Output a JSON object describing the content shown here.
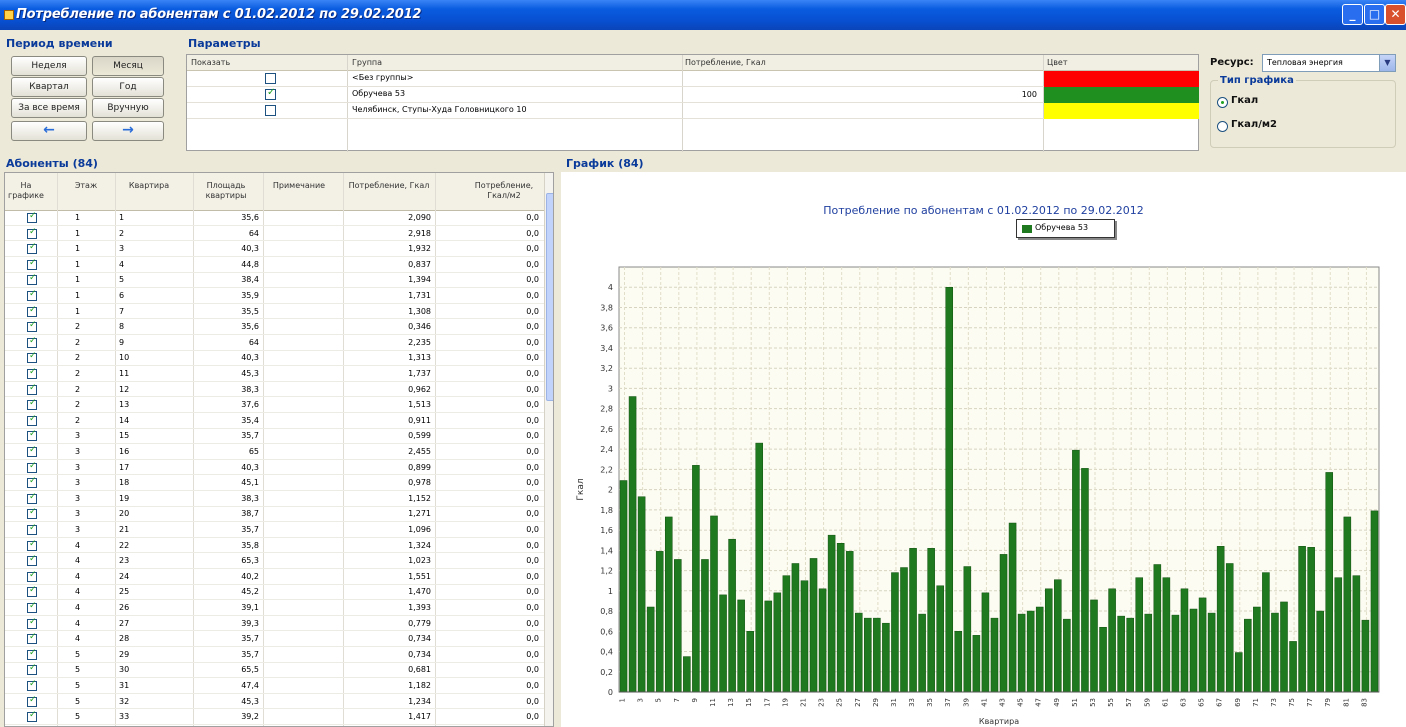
{
  "window": {
    "title": "Потребление по абонентам с 01.02.2012 по 29.02.2012"
  },
  "period": {
    "title": "Период времени",
    "buttons": [
      "Неделя",
      "Месяц",
      "Квартал",
      "Год",
      "За все время",
      "Вручную"
    ],
    "selected": "Месяц",
    "prev_icon": "arrow-left-icon",
    "next_icon": "arrow-right-icon"
  },
  "params": {
    "title": "Параметры",
    "columns": [
      "Показать",
      "Группа",
      "Потребление, Гкал",
      "Цвет"
    ],
    "rows": [
      {
        "show": false,
        "group": "<Без группы>",
        "value": "",
        "color": "#ff0000"
      },
      {
        "show": true,
        "group": "Обручева 53",
        "value": "100",
        "color": "#1f8f1f"
      },
      {
        "show": false,
        "group": "Челябинск, Ступы-Худа Головницкого 10",
        "value": "",
        "color": "#ffff00"
      }
    ]
  },
  "resource": {
    "label": "Ресурс:",
    "value": "Тепловая энергия"
  },
  "chart_type": {
    "title": "Тип графика",
    "options": [
      "Гкал",
      "Гкал/м2"
    ],
    "selected": "Гкал"
  },
  "subscribers": {
    "title": "Абоненты (84)",
    "columns": [
      "На графике",
      "Этаж",
      "Квартира",
      "Площадь квартиры",
      "Примечание",
      "Потребление, Гкал",
      "Потребление, Гкал/м2"
    ],
    "rows": [
      [
        "1",
        "1",
        "35,6",
        "",
        "2,090",
        "0,0"
      ],
      [
        "1",
        "2",
        "64",
        "",
        "2,918",
        "0,0"
      ],
      [
        "1",
        "3",
        "40,3",
        "",
        "1,932",
        "0,0"
      ],
      [
        "1",
        "4",
        "44,8",
        "",
        "0,837",
        "0,0"
      ],
      [
        "1",
        "5",
        "38,4",
        "",
        "1,394",
        "0,0"
      ],
      [
        "1",
        "6",
        "35,9",
        "",
        "1,731",
        "0,0"
      ],
      [
        "1",
        "7",
        "35,5",
        "",
        "1,308",
        "0,0"
      ],
      [
        "2",
        "8",
        "35,6",
        "",
        "0,346",
        "0,0"
      ],
      [
        "2",
        "9",
        "64",
        "",
        "2,235",
        "0,0"
      ],
      [
        "2",
        "10",
        "40,3",
        "",
        "1,313",
        "0,0"
      ],
      [
        "2",
        "11",
        "45,3",
        "",
        "1,737",
        "0,0"
      ],
      [
        "2",
        "12",
        "38,3",
        "",
        "0,962",
        "0,0"
      ],
      [
        "2",
        "13",
        "37,6",
        "",
        "1,513",
        "0,0"
      ],
      [
        "2",
        "14",
        "35,4",
        "",
        "0,911",
        "0,0"
      ],
      [
        "3",
        "15",
        "35,7",
        "",
        "0,599",
        "0,0"
      ],
      [
        "3",
        "16",
        "65",
        "",
        "2,455",
        "0,0"
      ],
      [
        "3",
        "17",
        "40,3",
        "",
        "0,899",
        "0,0"
      ],
      [
        "3",
        "18",
        "45,1",
        "",
        "0,978",
        "0,0"
      ],
      [
        "3",
        "19",
        "38,3",
        "",
        "1,152",
        "0,0"
      ],
      [
        "3",
        "20",
        "38,7",
        "",
        "1,271",
        "0,0"
      ],
      [
        "3",
        "21",
        "35,7",
        "",
        "1,096",
        "0,0"
      ],
      [
        "4",
        "22",
        "35,8",
        "",
        "1,324",
        "0,0"
      ],
      [
        "4",
        "23",
        "65,3",
        "",
        "1,023",
        "0,0"
      ],
      [
        "4",
        "24",
        "40,2",
        "",
        "1,551",
        "0,0"
      ],
      [
        "4",
        "25",
        "45,2",
        "",
        "1,470",
        "0,0"
      ],
      [
        "4",
        "26",
        "39,1",
        "",
        "1,393",
        "0,0"
      ],
      [
        "4",
        "27",
        "39,3",
        "",
        "0,779",
        "0,0"
      ],
      [
        "4",
        "28",
        "35,7",
        "",
        "0,734",
        "0,0"
      ],
      [
        "5",
        "29",
        "35,7",
        "",
        "0,734",
        "0,0"
      ],
      [
        "5",
        "30",
        "65,5",
        "",
        "0,681",
        "0,0"
      ],
      [
        "5",
        "31",
        "47,4",
        "",
        "1,182",
        "0,0"
      ],
      [
        "5",
        "32",
        "45,3",
        "",
        "1,234",
        "0,0"
      ],
      [
        "5",
        "33",
        "39,2",
        "",
        "1,417",
        "0,0"
      ]
    ]
  },
  "graph": {
    "title": "График (84)"
  },
  "chart_data": {
    "type": "bar",
    "title": "Потребление по абонентам с 01.02.2012 по 29.02.2012",
    "xlabel": "Квартира",
    "ylabel": "Гкал",
    "ylim": [
      0,
      4.2
    ],
    "yticks": [
      "0",
      "0,2",
      "0,4",
      "0,6",
      "0,8",
      "1",
      "1,2",
      "1,4",
      "1,6",
      "1,8",
      "2",
      "2,2",
      "2,4",
      "2,6",
      "2,8",
      "3",
      "3,2",
      "3,4",
      "3,6",
      "3,8",
      "4"
    ],
    "grid": true,
    "legend_position": "top-center",
    "bar_color": "#1f7a1f",
    "series": [
      {
        "name": "Обручева 53",
        "values": [
          2.09,
          2.92,
          1.93,
          0.84,
          1.39,
          1.73,
          1.31,
          0.35,
          2.24,
          1.31,
          1.74,
          0.96,
          1.51,
          0.91,
          0.6,
          2.46,
          0.9,
          0.98,
          1.15,
          1.27,
          1.1,
          1.32,
          1.02,
          1.55,
          1.47,
          1.39,
          0.78,
          0.73,
          0.73,
          0.68,
          1.18,
          1.23,
          1.42,
          0.77,
          1.42,
          1.05,
          4.0,
          0.6,
          1.24,
          0.56,
          0.98,
          0.73,
          1.36,
          1.67,
          0.77,
          0.8,
          0.84,
          1.02,
          1.11,
          0.72,
          2.39,
          2.21,
          0.91,
          0.64,
          1.02,
          0.75,
          0.73,
          1.13,
          0.77,
          1.26,
          1.13,
          0.76,
          1.02,
          0.82,
          0.93,
          0.78,
          1.44,
          1.27,
          0.39,
          0.72,
          0.84,
          1.18,
          0.78,
          0.89,
          0.5,
          1.44,
          1.43,
          0.8,
          2.17,
          1.13,
          1.73,
          1.15,
          0.71,
          1.79
        ]
      }
    ],
    "categories": [
      "1",
      "2",
      "3",
      "4",
      "5",
      "6",
      "7",
      "8",
      "9",
      "10",
      "11",
      "12",
      "13",
      "14",
      "15",
      "16",
      "17",
      "18",
      "19",
      "20",
      "21",
      "22",
      "23",
      "24",
      "25",
      "26",
      "27",
      "28",
      "29",
      "30",
      "31",
      "32",
      "33",
      "34",
      "35",
      "36",
      "37",
      "38",
      "39",
      "40",
      "41",
      "42",
      "43",
      "44",
      "45",
      "46",
      "47",
      "48",
      "49",
      "50",
      "51",
      "52",
      "53",
      "54",
      "55",
      "56",
      "57",
      "58",
      "59",
      "60",
      "61",
      "62",
      "63",
      "64",
      "65",
      "66",
      "67",
      "68",
      "69",
      "70",
      "71",
      "72",
      "73",
      "74",
      "75",
      "76",
      "77",
      "78",
      "79",
      "80",
      "81",
      "82",
      "83",
      "84"
    ]
  }
}
